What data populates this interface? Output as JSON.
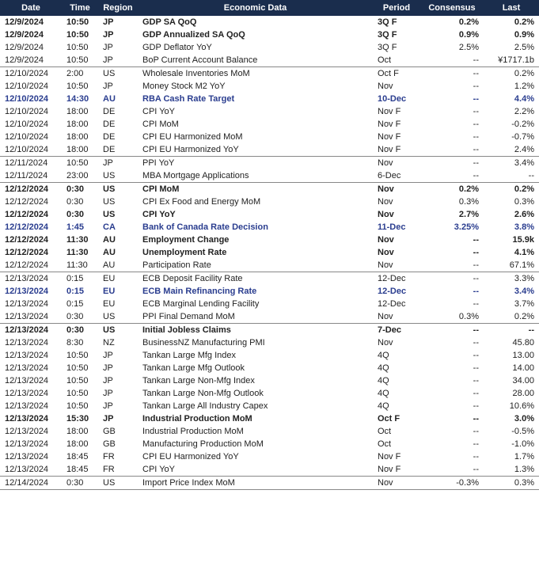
{
  "headers": {
    "date": "Date",
    "time": "Time",
    "region": "Region",
    "data": "Economic Data",
    "period": "Period",
    "consensus": "Consensus",
    "last": "Last"
  },
  "rows": [
    {
      "date": "12/9/2024",
      "time": "10:50",
      "region": "JP",
      "data": "GDP SA QoQ",
      "period": "3Q F",
      "consensus": "0.2%",
      "last": "0.2%",
      "style": "bold",
      "sep": false
    },
    {
      "date": "12/9/2024",
      "time": "10:50",
      "region": "JP",
      "data": "GDP Annualized SA QoQ",
      "period": "3Q F",
      "consensus": "0.9%",
      "last": "0.9%",
      "style": "bold",
      "sep": false
    },
    {
      "date": "12/9/2024",
      "time": "10:50",
      "region": "JP",
      "data": "GDP Deflator YoY",
      "period": "3Q F",
      "consensus": "2.5%",
      "last": "2.5%",
      "style": "",
      "sep": false
    },
    {
      "date": "12/9/2024",
      "time": "10:50",
      "region": "JP",
      "data": "BoP Current Account Balance",
      "period": "Oct",
      "consensus": "--",
      "last": "¥1717.1b",
      "style": "",
      "sep": false
    },
    {
      "date": "12/10/2024",
      "time": "2:00",
      "region": "US",
      "data": "Wholesale Inventories MoM",
      "period": "Oct F",
      "consensus": "--",
      "last": "0.2%",
      "style": "",
      "sep": true
    },
    {
      "date": "12/10/2024",
      "time": "10:50",
      "region": "JP",
      "data": "Money Stock M2 YoY",
      "period": "Nov",
      "consensus": "--",
      "last": "1.2%",
      "style": "",
      "sep": false
    },
    {
      "date": "12/10/2024",
      "time": "14:30",
      "region": "AU",
      "data": "RBA Cash Rate Target",
      "period": "10-Dec",
      "consensus": "--",
      "last": "4.4%",
      "style": "blue",
      "sep": false
    },
    {
      "date": "12/10/2024",
      "time": "18:00",
      "region": "DE",
      "data": "CPI YoY",
      "period": "Nov F",
      "consensus": "--",
      "last": "2.2%",
      "style": "",
      "sep": false
    },
    {
      "date": "12/10/2024",
      "time": "18:00",
      "region": "DE",
      "data": "CPI MoM",
      "period": "Nov F",
      "consensus": "--",
      "last": "-0.2%",
      "style": "",
      "sep": false
    },
    {
      "date": "12/10/2024",
      "time": "18:00",
      "region": "DE",
      "data": "CPI EU Harmonized MoM",
      "period": "Nov F",
      "consensus": "--",
      "last": "-0.7%",
      "style": "",
      "sep": false
    },
    {
      "date": "12/10/2024",
      "time": "18:00",
      "region": "DE",
      "data": "CPI EU Harmonized YoY",
      "period": "Nov F",
      "consensus": "--",
      "last": "2.4%",
      "style": "",
      "sep": false
    },
    {
      "date": "12/11/2024",
      "time": "10:50",
      "region": "JP",
      "data": "PPI YoY",
      "period": "Nov",
      "consensus": "--",
      "last": "3.4%",
      "style": "",
      "sep": true
    },
    {
      "date": "12/11/2024",
      "time": "23:00",
      "region": "US",
      "data": "MBA Mortgage Applications",
      "period": "6-Dec",
      "consensus": "--",
      "last": "--",
      "style": "",
      "sep": false
    },
    {
      "date": "12/12/2024",
      "time": "0:30",
      "region": "US",
      "data": "CPI MoM",
      "period": "Nov",
      "consensus": "0.2%",
      "last": "0.2%",
      "style": "bold",
      "sep": true
    },
    {
      "date": "12/12/2024",
      "time": "0:30",
      "region": "US",
      "data": "CPI Ex Food and Energy MoM",
      "period": "Nov",
      "consensus": "0.3%",
      "last": "0.3%",
      "style": "",
      "sep": false
    },
    {
      "date": "12/12/2024",
      "time": "0:30",
      "region": "US",
      "data": "CPI YoY",
      "period": "Nov",
      "consensus": "2.7%",
      "last": "2.6%",
      "style": "bold",
      "sep": false
    },
    {
      "date": "12/12/2024",
      "time": "1:45",
      "region": "CA",
      "data": "Bank of Canada Rate Decision",
      "period": "11-Dec",
      "consensus": "3.25%",
      "last": "3.8%",
      "style": "blue",
      "sep": false
    },
    {
      "date": "12/12/2024",
      "time": "11:30",
      "region": "AU",
      "data": "Employment Change",
      "period": "Nov",
      "consensus": "--",
      "last": "15.9k",
      "style": "bold",
      "sep": false
    },
    {
      "date": "12/12/2024",
      "time": "11:30",
      "region": "AU",
      "data": "Unemployment Rate",
      "period": "Nov",
      "consensus": "--",
      "last": "4.1%",
      "style": "bold",
      "sep": false
    },
    {
      "date": "12/12/2024",
      "time": "11:30",
      "region": "AU",
      "data": "Participation Rate",
      "period": "Nov",
      "consensus": "--",
      "last": "67.1%",
      "style": "",
      "sep": false
    },
    {
      "date": "12/13/2024",
      "time": "0:15",
      "region": "EU",
      "data": "ECB Deposit Facility Rate",
      "period": "12-Dec",
      "consensus": "--",
      "last": "3.3%",
      "style": "",
      "sep": true
    },
    {
      "date": "12/13/2024",
      "time": "0:15",
      "region": "EU",
      "data": "ECB Main Refinancing Rate",
      "period": "12-Dec",
      "consensus": "--",
      "last": "3.4%",
      "style": "blue",
      "sep": false
    },
    {
      "date": "12/13/2024",
      "time": "0:15",
      "region": "EU",
      "data": "ECB Marginal Lending Facility",
      "period": "12-Dec",
      "consensus": "--",
      "last": "3.7%",
      "style": "",
      "sep": false
    },
    {
      "date": "12/13/2024",
      "time": "0:30",
      "region": "US",
      "data": "PPI Final Demand MoM",
      "period": "Nov",
      "consensus": "0.3%",
      "last": "0.2%",
      "style": "",
      "sep": false
    },
    {
      "date": "12/13/2024",
      "time": "0:30",
      "region": "US",
      "data": "Initial Jobless Claims",
      "period": "7-Dec",
      "consensus": "--",
      "last": "--",
      "style": "bold",
      "sep": true
    },
    {
      "date": "12/13/2024",
      "time": "8:30",
      "region": "NZ",
      "data": "BusinessNZ Manufacturing PMI",
      "period": "Nov",
      "consensus": "--",
      "last": "45.80",
      "style": "",
      "sep": false
    },
    {
      "date": "12/13/2024",
      "time": "10:50",
      "region": "JP",
      "data": "Tankan Large Mfg Index",
      "period": "4Q",
      "consensus": "--",
      "last": "13.00",
      "style": "",
      "sep": false
    },
    {
      "date": "12/13/2024",
      "time": "10:50",
      "region": "JP",
      "data": "Tankan Large Mfg Outlook",
      "period": "4Q",
      "consensus": "--",
      "last": "14.00",
      "style": "",
      "sep": false
    },
    {
      "date": "12/13/2024",
      "time": "10:50",
      "region": "JP",
      "data": "Tankan Large Non-Mfg Index",
      "period": "4Q",
      "consensus": "--",
      "last": "34.00",
      "style": "",
      "sep": false
    },
    {
      "date": "12/13/2024",
      "time": "10:50",
      "region": "JP",
      "data": "Tankan Large Non-Mfg Outlook",
      "period": "4Q",
      "consensus": "--",
      "last": "28.00",
      "style": "",
      "sep": false
    },
    {
      "date": "12/13/2024",
      "time": "10:50",
      "region": "JP",
      "data": "Tankan Large All Industry Capex",
      "period": "4Q",
      "consensus": "--",
      "last": "10.6%",
      "style": "",
      "sep": false
    },
    {
      "date": "12/13/2024",
      "time": "15:30",
      "region": "JP",
      "data": "Industrial Production MoM",
      "period": "Oct F",
      "consensus": "--",
      "last": "3.0%",
      "style": "bold",
      "sep": false
    },
    {
      "date": "12/13/2024",
      "time": "18:00",
      "region": "GB",
      "data": "Industrial Production MoM",
      "period": "Oct",
      "consensus": "--",
      "last": "-0.5%",
      "style": "",
      "sep": false
    },
    {
      "date": "12/13/2024",
      "time": "18:00",
      "region": "GB",
      "data": "Manufacturing Production MoM",
      "period": "Oct",
      "consensus": "--",
      "last": "-1.0%",
      "style": "",
      "sep": false
    },
    {
      "date": "12/13/2024",
      "time": "18:45",
      "region": "FR",
      "data": "CPI EU Harmonized YoY",
      "period": "Nov F",
      "consensus": "--",
      "last": "1.7%",
      "style": "",
      "sep": false
    },
    {
      "date": "12/13/2024",
      "time": "18:45",
      "region": "FR",
      "data": "CPI YoY",
      "period": "Nov F",
      "consensus": "--",
      "last": "1.3%",
      "style": "",
      "sep": false
    },
    {
      "date": "12/14/2024",
      "time": "0:30",
      "region": "US",
      "data": "Import Price Index MoM",
      "period": "Nov",
      "consensus": "-0.3%",
      "last": "0.3%",
      "style": "",
      "sep": true
    }
  ]
}
